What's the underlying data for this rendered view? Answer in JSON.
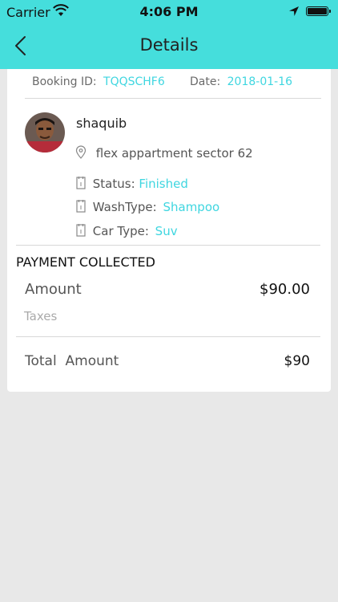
{
  "status_bar": {
    "carrier": "Carrier",
    "time": "4:06 PM"
  },
  "nav": {
    "title": "Details",
    "back_icon": "chevron-left-icon"
  },
  "booking": {
    "id_label": "Booking ID:",
    "id_value": "TQQSCHF6",
    "date_label": "Date:",
    "date_value": "2018-01-16"
  },
  "user": {
    "name": "shaquib",
    "address": "flex appartment sector 62"
  },
  "details": {
    "status_label": "Status:",
    "status_value": "Finished",
    "wash_type_label": "WashType:",
    "wash_type_value": "Shampoo",
    "car_type_label": "Car Type:",
    "car_type_value": "Suv"
  },
  "payment": {
    "section_title": "PAYMENT COLLECTED",
    "amount_label": "Amount",
    "amount_value": "$90.00",
    "taxes_label": "Taxes",
    "total_label": "Total  Amount",
    "total_value": "$90"
  },
  "colors": {
    "header_bg": "#45dedc",
    "accent": "#3fd6e0",
    "page_bg": "#e8e8e8"
  }
}
